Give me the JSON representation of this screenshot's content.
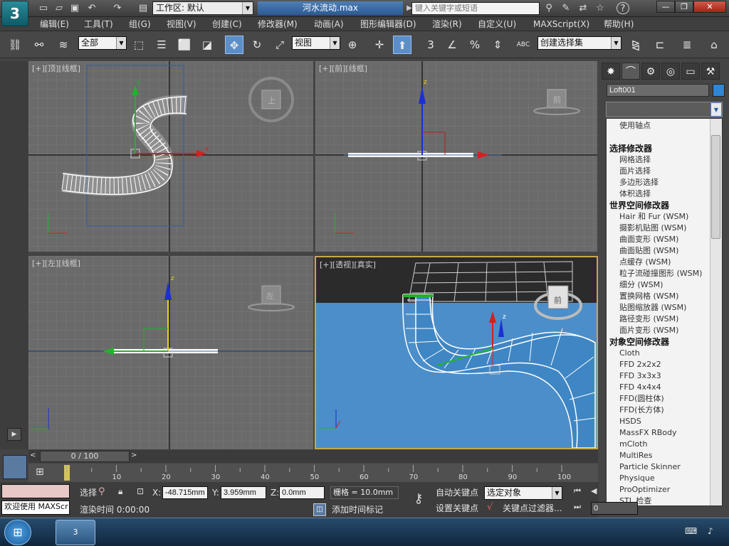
{
  "app": {
    "logo_letter": "3",
    "document_title": "河水流动.max"
  },
  "title_bar": {
    "workspace_label": "工作区: 默认",
    "search_placeholder": "键入关键字或短语",
    "window_buttons": {
      "minimize": "—",
      "restore": "❐",
      "close": "✕"
    }
  },
  "menu": {
    "items": [
      "编辑(E)",
      "工具(T)",
      "组(G)",
      "视图(V)",
      "创建(C)",
      "修改器(M)",
      "动画(A)",
      "图形编辑器(D)",
      "渲染(R)",
      "自定义(U)",
      "MAXScript(X)",
      "帮助(H)"
    ]
  },
  "toolbar": {
    "selection_filter": "全部",
    "ref_coord": "视图",
    "snap_label": "3",
    "angle_label": "%",
    "named_selection": "创建选择集",
    "abc_label": "ABC"
  },
  "viewports": {
    "top": {
      "label": "[+][顶][线框]",
      "cube_text": "上"
    },
    "front": {
      "label": "[+][前][线框]",
      "cube_text": "前"
    },
    "left": {
      "label": "[+][左][线框]",
      "cube_text": "左"
    },
    "persp": {
      "label": "[+][透视][真实]",
      "cube_text": "前"
    },
    "axis_labels": {
      "x": "x",
      "y": "y",
      "z": "z"
    }
  },
  "command_panel": {
    "object_name": "Loft001",
    "object_color": "#2e86d6",
    "modifier_list": [
      {
        "text": "使用轴点",
        "header": false
      },
      {
        "text": "",
        "header": false
      },
      {
        "text": "选择修改器",
        "header": true
      },
      {
        "text": "网格选择",
        "header": false
      },
      {
        "text": "面片选择",
        "header": false
      },
      {
        "text": "多边形选择",
        "header": false
      },
      {
        "text": "体积选择",
        "header": false
      },
      {
        "text": "世界空间修改器",
        "header": true
      },
      {
        "text": "Hair 和 Fur (WSM)",
        "header": false
      },
      {
        "text": "摄影机贴图 (WSM)",
        "header": false
      },
      {
        "text": "曲面变形 (WSM)",
        "header": false
      },
      {
        "text": "曲面贴图 (WSM)",
        "header": false
      },
      {
        "text": "点缓存 (WSM)",
        "header": false
      },
      {
        "text": "粒子流碰撞图形 (WSM)",
        "header": false
      },
      {
        "text": "细分 (WSM)",
        "header": false
      },
      {
        "text": "置换网格 (WSM)",
        "header": false
      },
      {
        "text": "贴图缩放器 (WSM)",
        "header": false
      },
      {
        "text": "路径变形 (WSM)",
        "header": false
      },
      {
        "text": "面片变形 (WSM)",
        "header": false
      },
      {
        "text": "对象空间修改器",
        "header": true
      },
      {
        "text": "Cloth",
        "header": false
      },
      {
        "text": "FFD 2x2x2",
        "header": false
      },
      {
        "text": "FFD 3x3x3",
        "header": false
      },
      {
        "text": "FFD 4x4x4",
        "header": false
      },
      {
        "text": "FFD(圆柱体)",
        "header": false
      },
      {
        "text": "FFD(长方体)",
        "header": false
      },
      {
        "text": "HSDS",
        "header": false
      },
      {
        "text": "MassFX RBody",
        "header": false
      },
      {
        "text": "mCloth",
        "header": false
      },
      {
        "text": "MultiRes",
        "header": false
      },
      {
        "text": "Particle Skinner",
        "header": false
      },
      {
        "text": "Physique",
        "header": false
      },
      {
        "text": "ProOptimizer",
        "header": false
      },
      {
        "text": "STL 检查",
        "header": false
      }
    ]
  },
  "timeline": {
    "frame_display": "0 / 100",
    "ticks": [
      "10",
      "20",
      "30",
      "40",
      "50",
      "60",
      "70",
      "80",
      "90",
      "100"
    ]
  },
  "status": {
    "selection_text": "选择",
    "x_label": "X:",
    "x_value": "-48.715mm",
    "y_label": "Y:",
    "y_value": "3.959mm",
    "z_label": "Z:",
    "z_value": "0.0mm",
    "grid_text": "栅格 = 10.0mm",
    "auto_key": "自动关键点",
    "set_key": "设置关键点",
    "key_mode": "选定对象",
    "key_filter": "关键点过滤器...",
    "add_time_tag": "添加时间标记",
    "render_time": "渲染时间  0:00:00",
    "welcome": "欢迎使用  MAXScr",
    "frame_field": "0"
  }
}
